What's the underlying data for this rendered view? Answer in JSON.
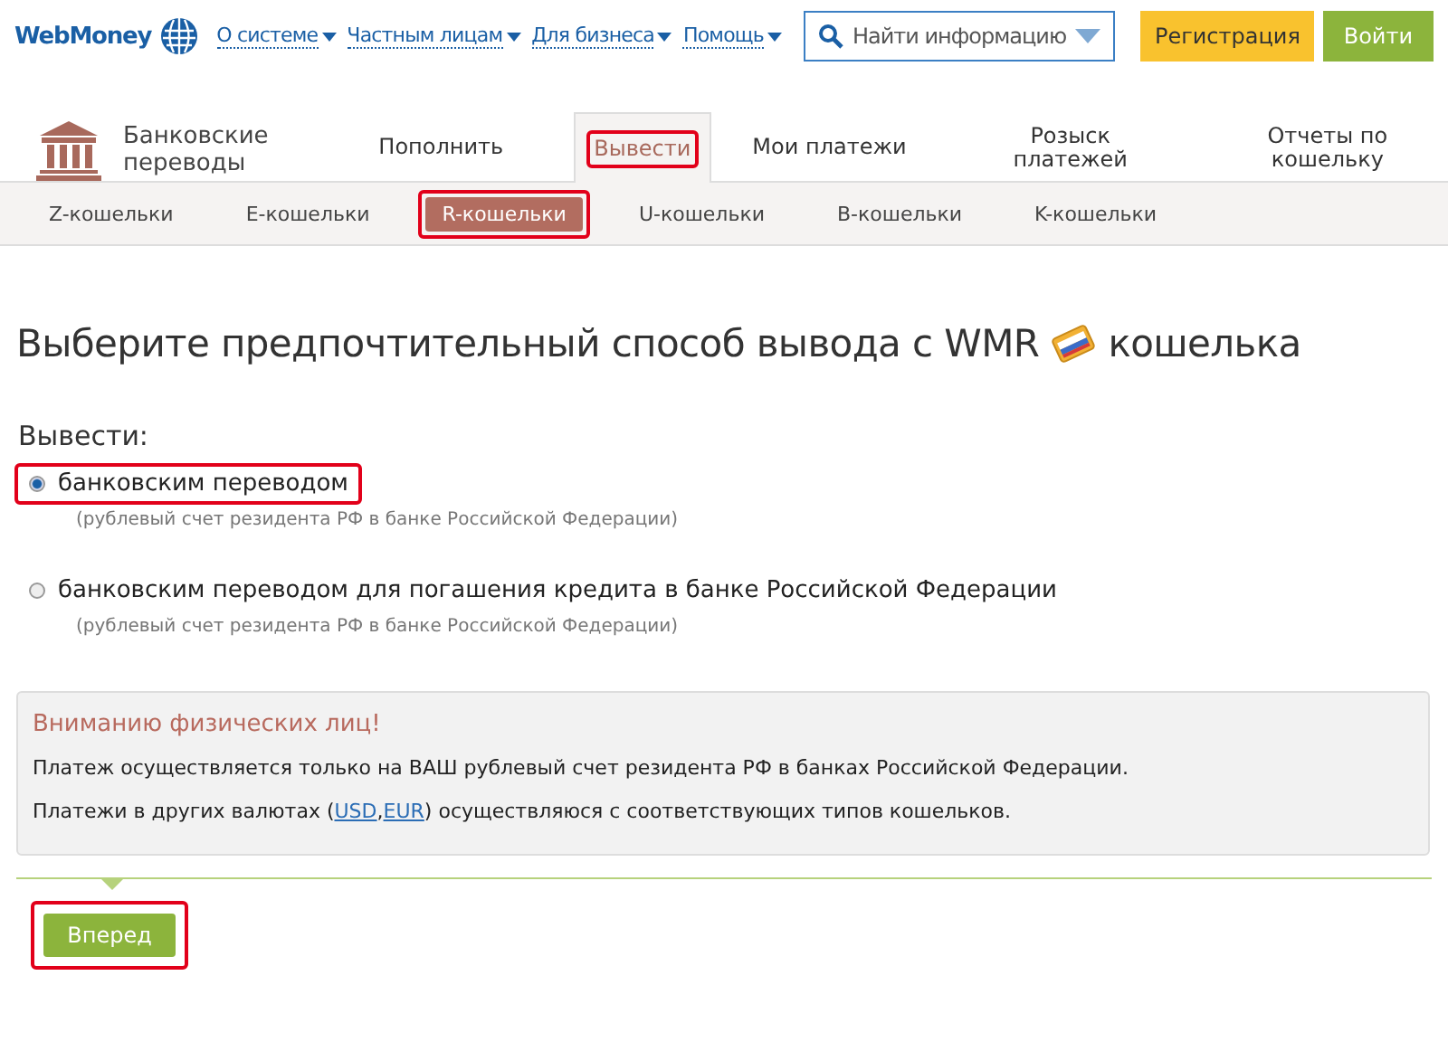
{
  "header": {
    "logo": "WebMoney",
    "nav": [
      {
        "label": "О системе"
      },
      {
        "label": "Частным лицам"
      },
      {
        "label": "Для бизнеса"
      },
      {
        "label": "Помощь"
      }
    ],
    "search": {
      "placeholder": "Найти информацию"
    },
    "buttons": [
      {
        "label": "Регистрация",
        "kind": "register"
      },
      {
        "label": "Войти",
        "kind": "login"
      }
    ]
  },
  "section": {
    "title": "Банковские переводы",
    "tabs": [
      {
        "label": "Пополнить",
        "selected": false,
        "highlighted": false
      },
      {
        "label": "Вывести",
        "selected": true,
        "highlighted": true
      },
      {
        "label": "Мои платежи",
        "selected": false,
        "highlighted": false
      },
      {
        "label": "Розыск платежей",
        "selected": false,
        "highlighted": false
      },
      {
        "label": "Отчеты по кошельку",
        "selected": false,
        "highlighted": false
      }
    ],
    "subtabs": [
      {
        "label": "Z-кошельки",
        "selected": false,
        "highlighted": false
      },
      {
        "label": "E-кошельки",
        "selected": false,
        "highlighted": false
      },
      {
        "label": "R-кошельки",
        "selected": true,
        "highlighted": true
      },
      {
        "label": "U-кошельки",
        "selected": false,
        "highlighted": false
      },
      {
        "label": "B-кошельки",
        "selected": false,
        "highlighted": false
      },
      {
        "label": "K-кошельки",
        "selected": false,
        "highlighted": false
      }
    ]
  },
  "heading": {
    "before": "Выберите предпочтительный способ вывода с WMR",
    "after": "кошелька"
  },
  "form": {
    "label": "Вывести:",
    "options": [
      {
        "label": "банковским переводом",
        "hint": "(рублевый счет резидента РФ в банке Российской Федерации)",
        "selected": true,
        "highlighted": true
      },
      {
        "label": "банковским переводом для погашения кредита в банке Российской Федерации",
        "hint": "(рублевый счет резидента РФ в банке Российской Федерации)",
        "selected": false,
        "highlighted": false
      }
    ]
  },
  "notice": {
    "title": "Вниманию физических лиц!",
    "paragraphs": [
      [
        {
          "text": "Платеж осуществляется только на ВАШ рублевый счет резидента РФ в банках Российской Федерации."
        }
      ],
      [
        {
          "text": "Платежи в других валютах ("
        },
        {
          "text": "USD",
          "kind": "link"
        },
        {
          "text": ","
        },
        {
          "text": "EUR",
          "kind": "link"
        },
        {
          "text": ") осуществляюся с соответствующих типов кошельков."
        }
      ]
    ]
  },
  "submit": {
    "label": "Вперед",
    "highlighted": true
  }
}
